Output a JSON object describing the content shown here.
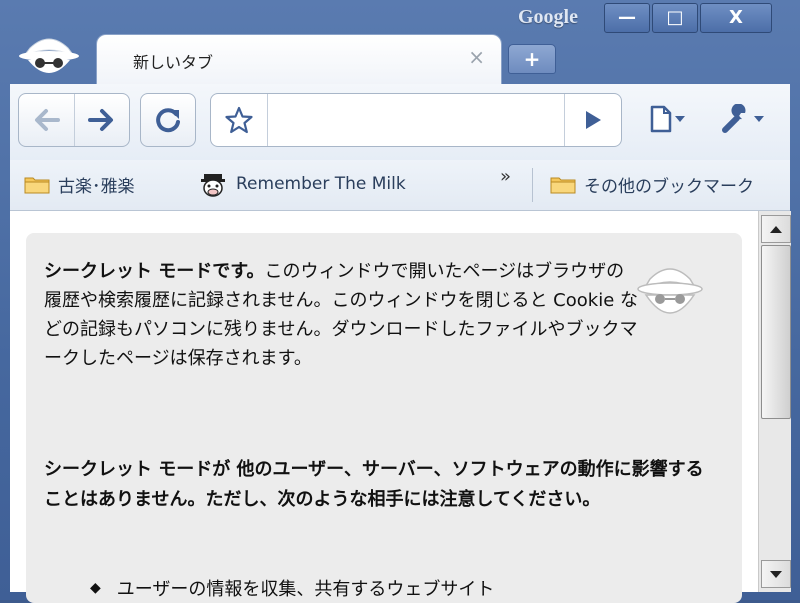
{
  "window": {
    "brand_label": "Google",
    "minimize_glyph": "—",
    "maximize_glyph": "□",
    "close_glyph": "X"
  },
  "tab": {
    "title": "新しいタブ",
    "close_glyph": "×",
    "new_tab_glyph": "+"
  },
  "toolbar": {
    "omnibox_value": "",
    "icons": [
      "back-arrow-icon",
      "forward-arrow-icon",
      "reload-icon",
      "star-icon",
      "go-arrow-icon",
      "page-icon",
      "wrench-icon"
    ]
  },
  "bookmarks": {
    "items": [
      {
        "label": "古楽･雅楽",
        "icon": "folder-icon"
      },
      {
        "label": "Remember The Milk",
        "icon": "cow-icon"
      }
    ],
    "overflow_glyph": "»",
    "other_label": "その他のブックマーク"
  },
  "content": {
    "para1_bold": "シークレット モードです。",
    "para1_text": "このウィンドウで開いたページはブラウザの 履歴や検索履歴に記録されません。このウィンドウを閉じると Cookie などの記録もパソコンに残りません。ダウンロードしたファイルやブックマークしたページは保存されます。",
    "para2": "シークレット モードが 他のユーザー、サーバー、ソフトウェアの動作に影響することはありません。ただし、次のような相手には注意してください。",
    "bullet1": "ユーザーの情報を収集、共有するウェブサイト"
  },
  "colors": {
    "frame": "#46689f",
    "toolbar_icon": "#3f5f96",
    "panel_bg": "#ececec"
  }
}
